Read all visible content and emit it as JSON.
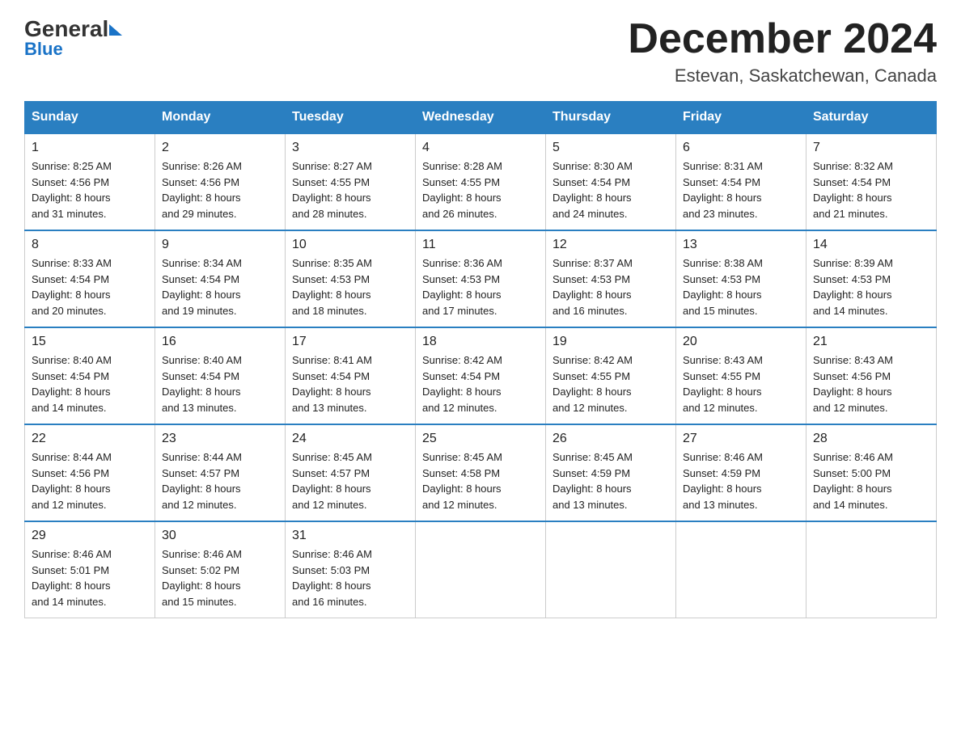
{
  "header": {
    "logo_general": "General",
    "logo_blue": "Blue",
    "month_year": "December 2024",
    "location": "Estevan, Saskatchewan, Canada"
  },
  "days_of_week": [
    "Sunday",
    "Monday",
    "Tuesday",
    "Wednesday",
    "Thursday",
    "Friday",
    "Saturday"
  ],
  "weeks": [
    [
      {
        "day": "1",
        "sunrise": "8:25 AM",
        "sunset": "4:56 PM",
        "daylight": "8 hours and 31 minutes."
      },
      {
        "day": "2",
        "sunrise": "8:26 AM",
        "sunset": "4:56 PM",
        "daylight": "8 hours and 29 minutes."
      },
      {
        "day": "3",
        "sunrise": "8:27 AM",
        "sunset": "4:55 PM",
        "daylight": "8 hours and 28 minutes."
      },
      {
        "day": "4",
        "sunrise": "8:28 AM",
        "sunset": "4:55 PM",
        "daylight": "8 hours and 26 minutes."
      },
      {
        "day": "5",
        "sunrise": "8:30 AM",
        "sunset": "4:54 PM",
        "daylight": "8 hours and 24 minutes."
      },
      {
        "day": "6",
        "sunrise": "8:31 AM",
        "sunset": "4:54 PM",
        "daylight": "8 hours and 23 minutes."
      },
      {
        "day": "7",
        "sunrise": "8:32 AM",
        "sunset": "4:54 PM",
        "daylight": "8 hours and 21 minutes."
      }
    ],
    [
      {
        "day": "8",
        "sunrise": "8:33 AM",
        "sunset": "4:54 PM",
        "daylight": "8 hours and 20 minutes."
      },
      {
        "day": "9",
        "sunrise": "8:34 AM",
        "sunset": "4:54 PM",
        "daylight": "8 hours and 19 minutes."
      },
      {
        "day": "10",
        "sunrise": "8:35 AM",
        "sunset": "4:53 PM",
        "daylight": "8 hours and 18 minutes."
      },
      {
        "day": "11",
        "sunrise": "8:36 AM",
        "sunset": "4:53 PM",
        "daylight": "8 hours and 17 minutes."
      },
      {
        "day": "12",
        "sunrise": "8:37 AM",
        "sunset": "4:53 PM",
        "daylight": "8 hours and 16 minutes."
      },
      {
        "day": "13",
        "sunrise": "8:38 AM",
        "sunset": "4:53 PM",
        "daylight": "8 hours and 15 minutes."
      },
      {
        "day": "14",
        "sunrise": "8:39 AM",
        "sunset": "4:53 PM",
        "daylight": "8 hours and 14 minutes."
      }
    ],
    [
      {
        "day": "15",
        "sunrise": "8:40 AM",
        "sunset": "4:54 PM",
        "daylight": "8 hours and 14 minutes."
      },
      {
        "day": "16",
        "sunrise": "8:40 AM",
        "sunset": "4:54 PM",
        "daylight": "8 hours and 13 minutes."
      },
      {
        "day": "17",
        "sunrise": "8:41 AM",
        "sunset": "4:54 PM",
        "daylight": "8 hours and 13 minutes."
      },
      {
        "day": "18",
        "sunrise": "8:42 AM",
        "sunset": "4:54 PM",
        "daylight": "8 hours and 12 minutes."
      },
      {
        "day": "19",
        "sunrise": "8:42 AM",
        "sunset": "4:55 PM",
        "daylight": "8 hours and 12 minutes."
      },
      {
        "day": "20",
        "sunrise": "8:43 AM",
        "sunset": "4:55 PM",
        "daylight": "8 hours and 12 minutes."
      },
      {
        "day": "21",
        "sunrise": "8:43 AM",
        "sunset": "4:56 PM",
        "daylight": "8 hours and 12 minutes."
      }
    ],
    [
      {
        "day": "22",
        "sunrise": "8:44 AM",
        "sunset": "4:56 PM",
        "daylight": "8 hours and 12 minutes."
      },
      {
        "day": "23",
        "sunrise": "8:44 AM",
        "sunset": "4:57 PM",
        "daylight": "8 hours and 12 minutes."
      },
      {
        "day": "24",
        "sunrise": "8:45 AM",
        "sunset": "4:57 PM",
        "daylight": "8 hours and 12 minutes."
      },
      {
        "day": "25",
        "sunrise": "8:45 AM",
        "sunset": "4:58 PM",
        "daylight": "8 hours and 12 minutes."
      },
      {
        "day": "26",
        "sunrise": "8:45 AM",
        "sunset": "4:59 PM",
        "daylight": "8 hours and 13 minutes."
      },
      {
        "day": "27",
        "sunrise": "8:46 AM",
        "sunset": "4:59 PM",
        "daylight": "8 hours and 13 minutes."
      },
      {
        "day": "28",
        "sunrise": "8:46 AM",
        "sunset": "5:00 PM",
        "daylight": "8 hours and 14 minutes."
      }
    ],
    [
      {
        "day": "29",
        "sunrise": "8:46 AM",
        "sunset": "5:01 PM",
        "daylight": "8 hours and 14 minutes."
      },
      {
        "day": "30",
        "sunrise": "8:46 AM",
        "sunset": "5:02 PM",
        "daylight": "8 hours and 15 minutes."
      },
      {
        "day": "31",
        "sunrise": "8:46 AM",
        "sunset": "5:03 PM",
        "daylight": "8 hours and 16 minutes."
      },
      null,
      null,
      null,
      null
    ]
  ]
}
